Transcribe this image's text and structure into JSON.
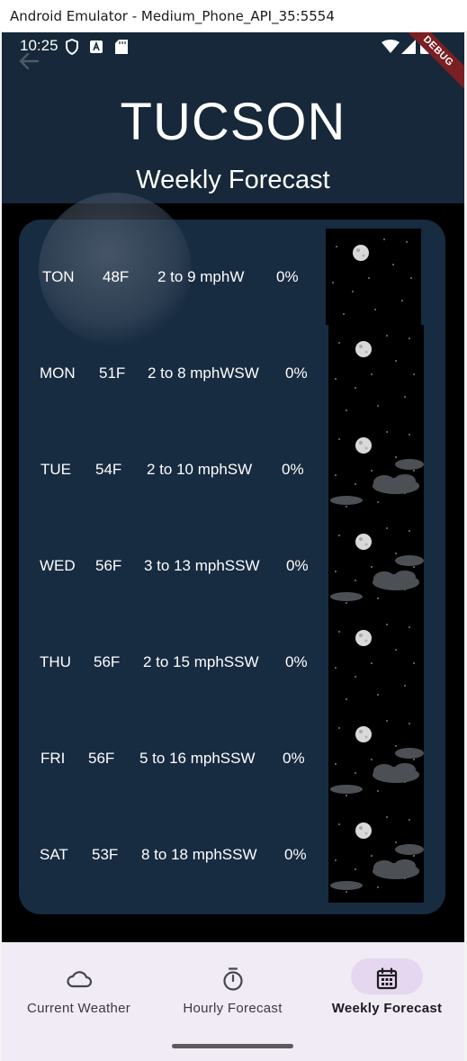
{
  "window": {
    "title": "Android Emulator - Medium_Phone_API_35:5554"
  },
  "status_bar": {
    "time": "10:25",
    "debug_banner": "DEBUG"
  },
  "header": {
    "city": "TUCSON",
    "subtitle": "Weekly Forecast"
  },
  "forecast": [
    {
      "day": "TON",
      "temp": "48F",
      "wind": "2 to 9 mphW",
      "precip": "0%",
      "icon": "clear-night-moon",
      "clouds": false
    },
    {
      "day": "MON",
      "temp": "51F",
      "wind": "2 to 8 mphWSW",
      "precip": "0%",
      "icon": "clear-night-moon",
      "clouds": false
    },
    {
      "day": "TUE",
      "temp": "54F",
      "wind": "2 to 10 mphSW",
      "precip": "0%",
      "icon": "partly-cloudy-night",
      "clouds": true
    },
    {
      "day": "WED",
      "temp": "56F",
      "wind": "3 to 13 mphSSW",
      "precip": "0%",
      "icon": "partly-cloudy-night",
      "clouds": true
    },
    {
      "day": "THU",
      "temp": "56F",
      "wind": "2 to 15 mphSSW",
      "precip": "0%",
      "icon": "clear-night-moon",
      "clouds": false
    },
    {
      "day": "FRI",
      "temp": "56F",
      "wind": "5 to 16 mphSSW",
      "precip": "0%",
      "icon": "partly-cloudy-night",
      "clouds": true
    },
    {
      "day": "SAT",
      "temp": "53F",
      "wind": "8 to 18 mphSSW",
      "precip": "0%",
      "icon": "partly-cloudy-night",
      "clouds": true
    }
  ],
  "nav": {
    "items": [
      {
        "label": "Current Weather",
        "icon": "cloud-icon",
        "active": false
      },
      {
        "label": "Hourly Forecast",
        "icon": "stopwatch-icon",
        "active": false
      },
      {
        "label": "Weekly Forecast",
        "icon": "calendar-icon",
        "active": true
      }
    ]
  },
  "colors": {
    "header_bg": "#162839",
    "card_bg": "#172b41",
    "nav_bg": "#f1ebf5",
    "nav_active_pill": "#e4d7ef",
    "debug_ribbon": "#7a1f22"
  }
}
